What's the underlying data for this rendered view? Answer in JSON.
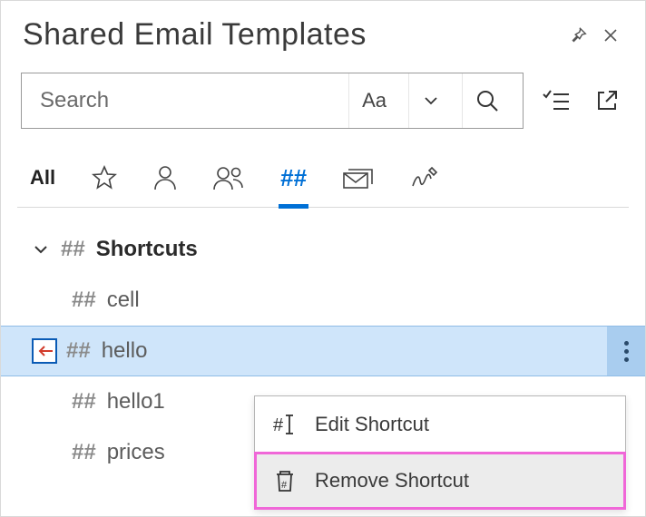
{
  "header": {
    "title": "Shared Email Templates"
  },
  "search": {
    "placeholder": "Search",
    "case_label": "Aa"
  },
  "tabs": {
    "all_label": "All",
    "hash_label": "##"
  },
  "tree": {
    "group_mark": "##",
    "group_label": "Shortcuts",
    "items": [
      {
        "mark": "##",
        "label": "cell"
      },
      {
        "mark": "##",
        "label": "hello"
      },
      {
        "mark": "##",
        "label": "hello1"
      },
      {
        "mark": "##",
        "label": "prices"
      }
    ]
  },
  "menu": {
    "edit_label": "Edit Shortcut",
    "remove_label": "Remove Shortcut"
  }
}
